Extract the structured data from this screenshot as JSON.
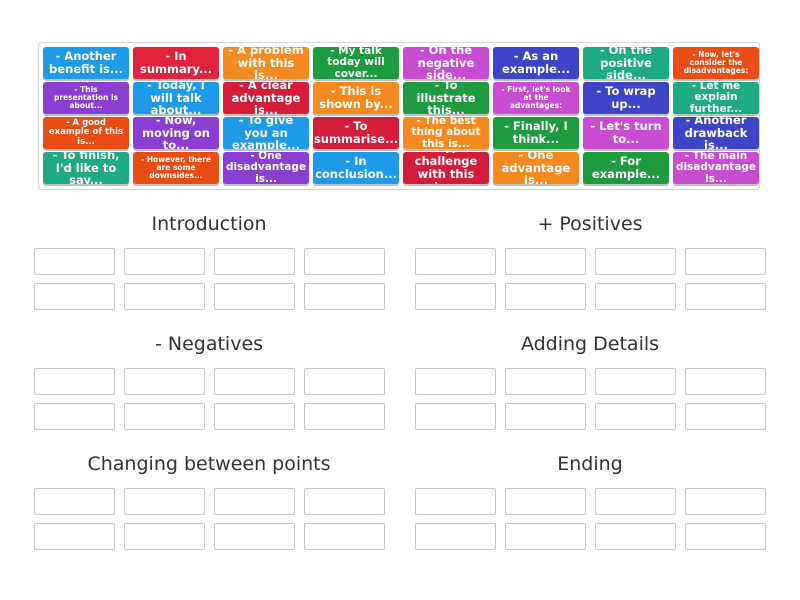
{
  "palette": {
    "blue": "#1e9be8",
    "red": "#e2233b",
    "orange": "#f48a21",
    "green": "#1e9a3f",
    "magenta": "#c94dd3",
    "navy": "#3d44c8",
    "teal": "#1eaa82",
    "vermilion": "#ea4d14",
    "purple": "#8a3fd2",
    "crimson": "#d41d3b"
  },
  "tiles": [
    {
      "label": "- Another benefit is...",
      "color": "#1e9be8",
      "size": "l"
    },
    {
      "label": "- In summary...",
      "color": "#e2233b",
      "size": "l"
    },
    {
      "label": "- A problem with this is...",
      "color": "#f48a21",
      "size": "l"
    },
    {
      "label": "- My talk today will cover...",
      "color": "#1e9a3f",
      "size": "m"
    },
    {
      "label": "- On the negative side...",
      "color": "#c94dd3",
      "size": "l"
    },
    {
      "label": "- As an example...",
      "color": "#3d44c8",
      "size": "l"
    },
    {
      "label": "- On the positive side...",
      "color": "#1eaa82",
      "size": "l"
    },
    {
      "label": "- Now, let's consider the disadvantages:",
      "color": "#ea4d14",
      "size": "xs"
    },
    {
      "label": "- This presentation is about...",
      "color": "#8a3fd2",
      "size": "xs"
    },
    {
      "label": "- Today, I will talk about...",
      "color": "#1e9be8",
      "size": "l"
    },
    {
      "label": "- A clear advantage is...",
      "color": "#d41d3b",
      "size": "l"
    },
    {
      "label": "- This is shown by...",
      "color": "#f48a21",
      "size": "l"
    },
    {
      "label": "- To illustrate this...",
      "color": "#1e9a3f",
      "size": "l"
    },
    {
      "label": "- First, let's look at the advantages:",
      "color": "#c94dd3",
      "size": "xs"
    },
    {
      "label": "- To wrap up...",
      "color": "#3d44c8",
      "size": "l"
    },
    {
      "label": "- Let me explain further...",
      "color": "#1eaa82",
      "size": "m"
    },
    {
      "label": "- A good example of this is...",
      "color": "#ea4d14",
      "size": "s"
    },
    {
      "label": "- Now, moving on to...",
      "color": "#8a3fd2",
      "size": "l"
    },
    {
      "label": "- To give you an example...",
      "color": "#1e9be8",
      "size": "l"
    },
    {
      "label": "- To summarise...",
      "color": "#d41d3b",
      "size": "l"
    },
    {
      "label": "- The best thing about this is...",
      "color": "#f48a21",
      "size": "m"
    },
    {
      "label": "- Finally, I think...",
      "color": "#1e9a3f",
      "size": "l"
    },
    {
      "label": "- Let's turn to...",
      "color": "#c94dd3",
      "size": "l"
    },
    {
      "label": "- Another drawback is...",
      "color": "#3d44c8",
      "size": "l"
    },
    {
      "label": "- To finish, I'd like to say...",
      "color": "#1eaa82",
      "size": "l"
    },
    {
      "label": "- However, there are some downsides...",
      "color": "#ea4d14",
      "size": "xs"
    },
    {
      "label": "- One disadvantage is...",
      "color": "#8a3fd2",
      "size": "m"
    },
    {
      "label": "- In conclusion...",
      "color": "#1e9be8",
      "size": "l"
    },
    {
      "label": "- A challenge with this is...",
      "color": "#d41d3b",
      "size": "l"
    },
    {
      "label": "- One advantage is...",
      "color": "#f48a21",
      "size": "l"
    },
    {
      "label": "- For example...",
      "color": "#1e9a3f",
      "size": "l"
    },
    {
      "label": "- The main disadvantage is...",
      "color": "#c94dd3",
      "size": "m"
    }
  ],
  "groups": [
    {
      "title": "Introduction"
    },
    {
      "title": "+ Positives"
    },
    {
      "title": "- Negatives"
    },
    {
      "title": "Adding Details"
    },
    {
      "title": "Changing between points"
    },
    {
      "title": "Ending"
    }
  ]
}
